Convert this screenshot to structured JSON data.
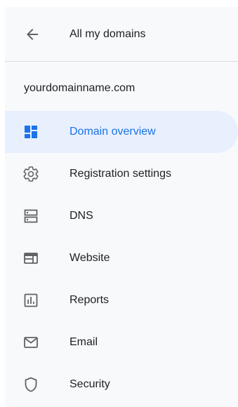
{
  "header": {
    "back_label": "All my domains"
  },
  "domain": {
    "name": "yourdomainname.com"
  },
  "nav": {
    "items": [
      {
        "label": "Domain overview",
        "icon": "dashboard-icon",
        "active": true
      },
      {
        "label": "Registration settings",
        "icon": "gear-icon",
        "active": false
      },
      {
        "label": "DNS",
        "icon": "dns-icon",
        "active": false
      },
      {
        "label": "Website",
        "icon": "website-icon",
        "active": false
      },
      {
        "label": "Reports",
        "icon": "chart-icon",
        "active": false
      },
      {
        "label": "Email",
        "icon": "mail-icon",
        "active": false
      },
      {
        "label": "Security",
        "icon": "shield-icon",
        "active": false
      }
    ]
  },
  "colors": {
    "accent": "#1a73e8",
    "active_bg": "#e8f0fe",
    "sidebar_bg": "#f8f9fa",
    "text": "#202124",
    "icon": "#5f6368"
  }
}
